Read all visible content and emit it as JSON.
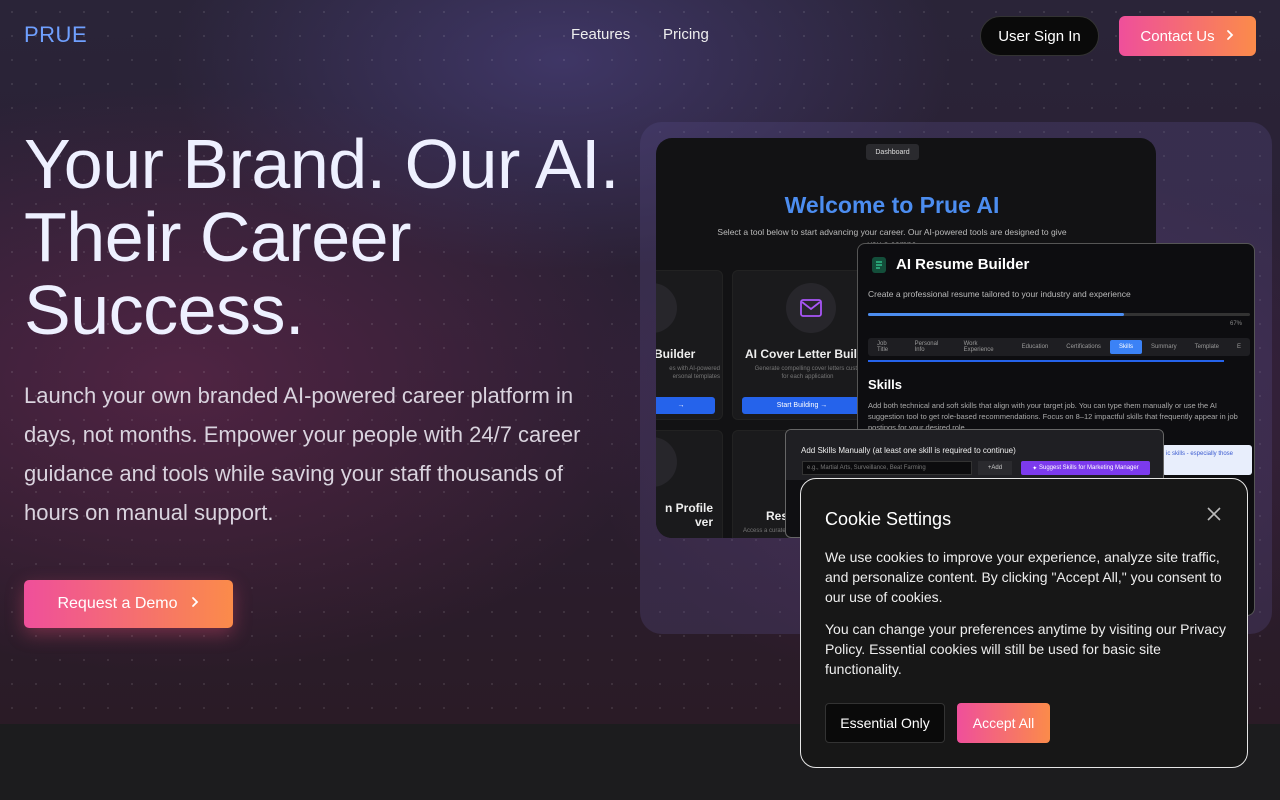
{
  "nav": {
    "logo": "PRUE",
    "links": [
      "Features",
      "Pricing"
    ],
    "signin_label": "User Sign In",
    "contact_label": "Contact Us"
  },
  "hero": {
    "title_lines": [
      "Your Brand. Our AI.",
      "Their Career",
      "Success."
    ],
    "lead": "Launch your own branded AI-powered career platform in days, not months. Empower your people with 24/7 career guidance and tools while saving your staff thousands of hours on manual support.",
    "demo_label": "Request a Demo"
  },
  "preview": {
    "dashboard_tag": "Dashboard",
    "welcome": "Welcome to Prue AI",
    "welcome_sub": "Select a tool below to start advancing your career. Our AI-powered tools are designed to give you a compe",
    "cards": [
      {
        "title": "Builder",
        "desc": "es with AI-powered\nersonal templates",
        "button": ""
      },
      {
        "title": "AI Cover Letter Buil",
        "desc": "Generate compelling cover letters custo\nfor each application",
        "button": "Start Building"
      },
      {
        "title": "n Profile\nver",
        "desc": "",
        "button": ""
      },
      {
        "title": "Res",
        "desc": "Access a curate",
        "button": ""
      }
    ],
    "resume": {
      "title": "AI Resume Builder",
      "subtitle": "Create a professional resume tailored to your industry and experience",
      "progress": 0.67,
      "progress_label": "67%",
      "tabs": [
        "Job Title",
        "Personal Info",
        "Work Experience",
        "Education",
        "Certifications",
        "Skills",
        "Summary",
        "Template",
        "E"
      ],
      "active_tab": "Skills",
      "heading": "Skills",
      "paragraph": "Add both technical and soft skills that align with your target job. You can type them manually or use the AI suggestion tool to get role-based recommendations. Focus on 8–12 impactful skills that frequently appear in job postings for your desired role.",
      "hint": "ic skills - especially those"
    },
    "skills_panel": {
      "title": "Add Skills Manually (at least one skill is required to continue)",
      "placeholder": "e.g., Martial Arts, Surveillance, Beat Farming",
      "add_label": "Add",
      "suggest_label": "Suggest Skills for Marketing Manager"
    }
  },
  "cookie": {
    "title": "Cookie Settings",
    "p1": "We use cookies to improve your experience, analyze site traffic, and personalize content. By clicking \"Accept All,\" you consent to our use of cookies.",
    "p2": "You can change your preferences anytime by visiting our Privacy Policy. Essential cookies will still be used for basic site functionality.",
    "essential_label": "Essential Only",
    "accept_label": "Accept All"
  },
  "colors": {
    "brand_blue": "#6fa0ff",
    "gradient_start": "#ef4f9b",
    "gradient_end": "#fb8b4a"
  },
  "icons": [
    "chevron-right-icon",
    "mail-icon",
    "document-icon",
    "close-icon",
    "sparkle-icon"
  ]
}
